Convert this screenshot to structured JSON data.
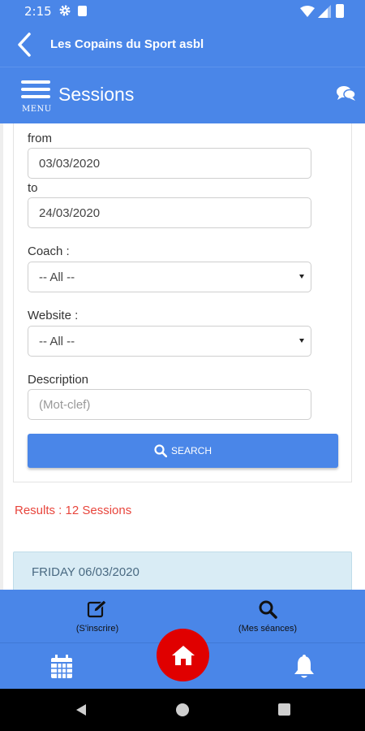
{
  "status_bar": {
    "time": "2:15"
  },
  "app_bar": {
    "title": "Les Copains du Sport asbl"
  },
  "section": {
    "menu_label": "MENU",
    "title": "Sessions"
  },
  "filters": {
    "from_label": "from",
    "from_value": "03/03/2020",
    "to_label": "to",
    "to_value": "24/03/2020",
    "coach_label": "Coach :",
    "coach_value": "-- All --",
    "website_label": "Website :",
    "website_value": "-- All --",
    "description_label": "Description",
    "description_placeholder": "(Mot-clef)",
    "search_label": "SEARCH"
  },
  "results": {
    "text": "Results : 12 Sessions"
  },
  "day_panel": {
    "text": "FRIDAY 06/03/2020"
  },
  "bottom_nav": {
    "register_label": "(S'inscrire)",
    "my_sessions_label": "(Mes séances)"
  },
  "colors": {
    "primary": "#4a86e8",
    "home": "#e00000",
    "results": "#e8453c",
    "day_panel": "#d9ecf5"
  },
  "icons": [
    "settings-gear-icon",
    "sim-card-icon",
    "wifi-icon",
    "signal-icon",
    "battery-icon",
    "back-arrow-icon",
    "hamburger-menu-icon",
    "chat-icon",
    "search-icon",
    "edit-icon",
    "calendar-icon",
    "home-icon",
    "bell-icon"
  ]
}
